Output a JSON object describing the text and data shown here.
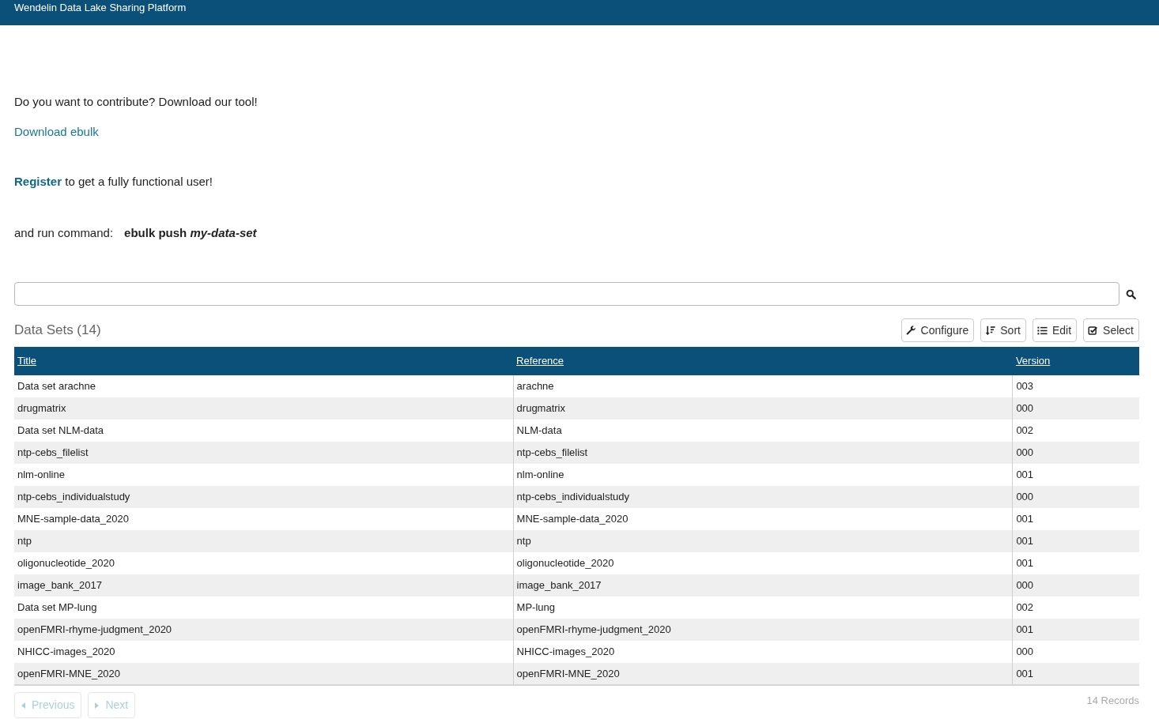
{
  "header": {
    "title": "Wendelin Data Lake Sharing Platform"
  },
  "intro": {
    "question": "Do you want to contribute? Download our tool!",
    "download_link": "Download ebulk",
    "register_link": "Register",
    "register_text": "to get a fully functional user!",
    "command_label": "and run command:",
    "command": "ebulk push *my-data-set*"
  },
  "listbox": {
    "title": "Data Sets (14)",
    "buttons": [
      {
        "label": "Configure"
      },
      {
        "label": "Sort"
      },
      {
        "label": "Edit"
      },
      {
        "label": "Select"
      }
    ],
    "table": {
      "columns": [
        "Title",
        "Reference",
        "Version"
      ],
      "rows": [
        [
          "Data set arachne",
          "arachne",
          "003"
        ],
        [
          "drugmatrix",
          "drugmatrix",
          "000"
        ],
        [
          "Data set NLM-data",
          "NLM-data",
          "002"
        ],
        [
          "ntp-cebs_filelist",
          "ntp-cebs_filelist",
          "000"
        ],
        [
          "nlm-online",
          "nlm-online",
          "001"
        ],
        [
          "ntp-cebs_individualstudy",
          "ntp-cebs_individualstudy",
          "000"
        ],
        [
          "MNE-sample-data_2020",
          "MNE-sample-data_2020",
          "001"
        ],
        [
          "ntp",
          "ntp",
          "001"
        ],
        [
          "oligonucleotide_2020",
          "oligonucleotide_2020",
          "001"
        ],
        [
          "image_bank_2017",
          "image_bank_2017",
          "000"
        ],
        [
          "Data set MP-lung",
          "MP-lung",
          "002"
        ],
        [
          "openFMRI-rhyme-judgment_2020",
          "openFMRI-rhyme-judgment_2020",
          "001"
        ],
        [
          "NHICC-images_2020",
          "NHICC-images_2020",
          "000"
        ],
        [
          "openFMRI-MNE_2020",
          "openFMRI-MNE_2020",
          "001"
        ]
      ]
    },
    "pagination": [
      {
        "label": "Previous",
        "disabled": true
      },
      {
        "label": "Next",
        "disabled": true
      }
    ],
    "record_count": "14 Records"
  }
}
